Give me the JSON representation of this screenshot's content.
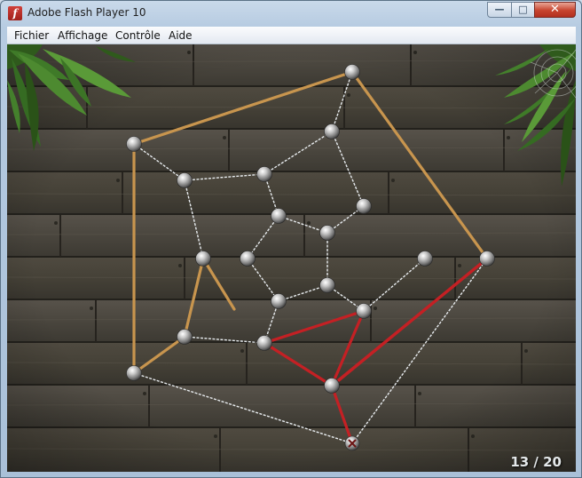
{
  "window": {
    "title": "Adobe Flash Player 10",
    "app_icon_glyph": "f",
    "controls": {
      "minimize": "—",
      "maximize": "□",
      "close": "✕"
    }
  },
  "menu": [
    {
      "label": "Fichier"
    },
    {
      "label": "Affichage"
    },
    {
      "label": "Contrôle"
    },
    {
      "label": "Aide"
    }
  ],
  "game": {
    "progress_text": "13 / 20",
    "colors": {
      "rope": "#c8954e",
      "thread": "#e7ebee",
      "tension": "#c42024",
      "wood": "#4a463b"
    },
    "pins": [
      {
        "id": "p1",
        "state": "normal"
      },
      {
        "id": "p2",
        "state": "normal"
      },
      {
        "id": "p3",
        "state": "normal"
      },
      {
        "id": "p4",
        "state": "normal"
      },
      {
        "id": "p5",
        "state": "normal"
      },
      {
        "id": "p6",
        "state": "normal"
      },
      {
        "id": "p7",
        "state": "normal"
      },
      {
        "id": "p8",
        "state": "normal"
      },
      {
        "id": "p9",
        "state": "normal"
      },
      {
        "id": "p10",
        "state": "normal"
      },
      {
        "id": "p11",
        "state": "normal"
      },
      {
        "id": "p12",
        "state": "normal"
      },
      {
        "id": "p13",
        "state": "normal"
      },
      {
        "id": "p14",
        "state": "normal"
      },
      {
        "id": "p15",
        "state": "normal"
      },
      {
        "id": "p16",
        "state": "normal"
      },
      {
        "id": "p17",
        "state": "normal"
      },
      {
        "id": "p18",
        "state": "normal"
      },
      {
        "id": "p19",
        "state": "normal"
      },
      {
        "id": "p20",
        "state": "selected"
      }
    ]
  }
}
